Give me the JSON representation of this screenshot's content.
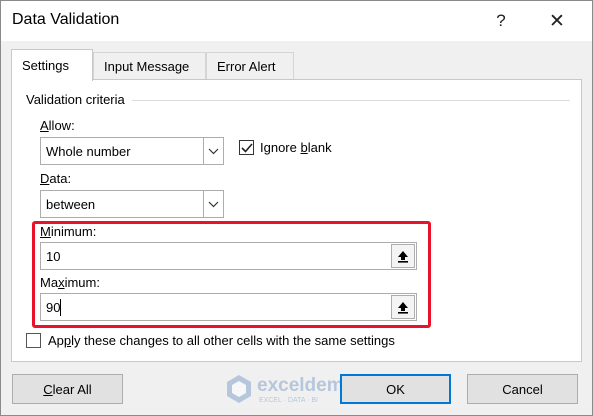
{
  "window": {
    "title": "Data Validation",
    "help_glyph": "?",
    "close_glyph": "✕"
  },
  "tabs": [
    {
      "label": "Settings",
      "active": true
    },
    {
      "label": "Input Message",
      "active": false
    },
    {
      "label": "Error Alert",
      "active": false
    }
  ],
  "criteria": {
    "group_title": "Validation criteria",
    "allow": {
      "label_u": "A",
      "label_rest": "llow:",
      "value": "Whole number"
    },
    "ignore_blank": {
      "checked": true,
      "label_pre": "Ignore ",
      "label_u": "b",
      "label_post": "lank"
    },
    "data": {
      "label_u": "D",
      "label_rest": "ata:",
      "value": "between"
    },
    "minimum": {
      "label_u": "M",
      "label_rest": "inimum:",
      "value": "10"
    },
    "maximum": {
      "label_pre": "Ma",
      "label_u": "x",
      "label_post": "imum:",
      "value": "90"
    }
  },
  "apply_all": {
    "checked": false,
    "label_pre": "Ap",
    "label_u": "p",
    "label_post": "ly these changes to all other cells with the same settings"
  },
  "buttons": {
    "clear_all_u": "C",
    "clear_all_rest": "lear All",
    "ok": "OK",
    "cancel": "Cancel"
  },
  "watermark": {
    "name": "exceldemy",
    "tagline": "EXCEL · DATA · BI"
  },
  "colors": {
    "highlight": "#e8132a",
    "ok_border": "#0078d7"
  }
}
